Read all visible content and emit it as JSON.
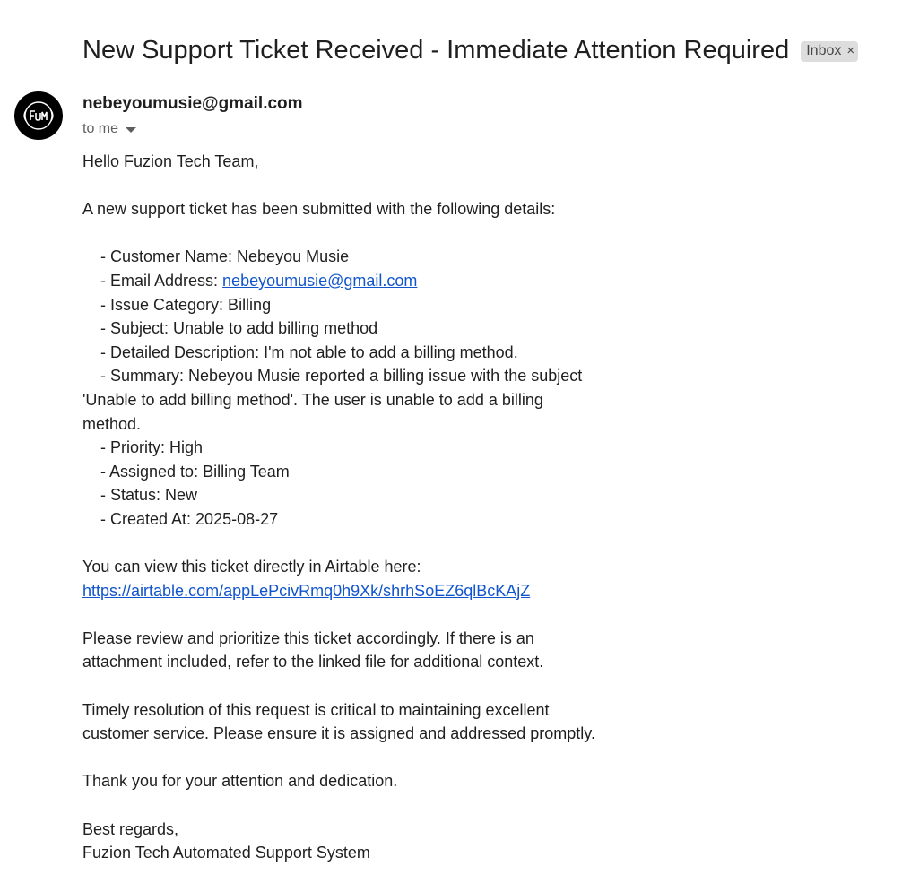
{
  "email": {
    "subject": "New Support Ticket Received - Immediate Attention Required",
    "label_chip": "Inbox",
    "label_remove": "×",
    "sender": "nebeyoumusie@gmail.com",
    "recipient": "to me",
    "avatar_icon": "fuzion-logo-icon"
  },
  "body": {
    "greeting": "Hello Fuzion Tech Team,",
    "intro": "A new support ticket has been submitted with the following details:",
    "details": {
      "customer_name": "- Customer Name: Nebeyou Musie",
      "email_prefix": "- Email Address: ",
      "email_link": "nebeyoumusie@gmail.com",
      "issue_category": "- Issue Category: Billing",
      "subject": "- Subject: Unable to add billing method",
      "description": "- Detailed Description: I'm not able to add a billing method.",
      "summary_line1": "- Summary: Nebeyou Musie reported a billing issue with the subject",
      "summary_line2": "'Unable to add billing method'. The user is unable to add a billing",
      "summary_line3": "method.",
      "priority": "- Priority: High",
      "assigned_to": "- Assigned to: Billing Team",
      "status": "- Status: New",
      "created_at": "- Created At: 2025-08-27"
    },
    "view_text": "You can view this ticket directly in Airtable here:",
    "airtable_link": "https://airtable.com/appLePcivRmq0h9Xk/shrhSoEZ6qlBcKAjZ",
    "review_line1": "Please review and prioritize this ticket accordingly. If there is an",
    "review_line2": "attachment included, refer to the linked file for additional context.",
    "timely_line1": "Timely resolution of this request is critical to maintaining excellent",
    "timely_line2": "customer service. Please ensure it is assigned and addressed promptly.",
    "thanks": "Thank you for your attention and dedication.",
    "sign_off": "Best regards,",
    "signature": "Fuzion Tech Automated Support System"
  },
  "colors": {
    "link": "#1155cc",
    "chip_bg": "#dddddd",
    "text": "#1f1f1f",
    "muted": "#5e5e5e"
  }
}
